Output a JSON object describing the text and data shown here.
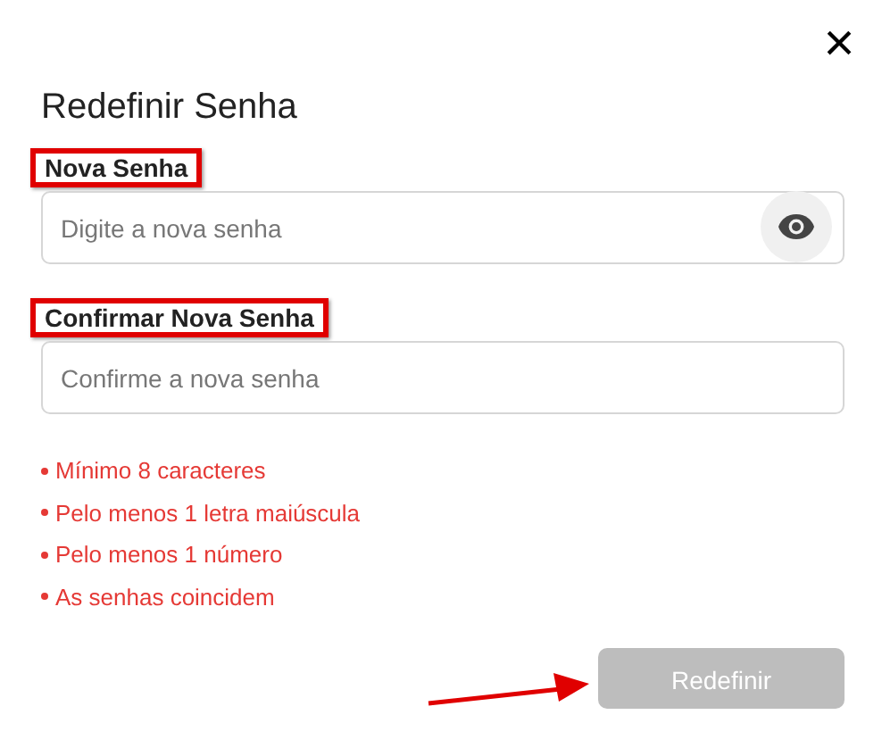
{
  "dialog": {
    "title": "Redefinir Senha",
    "close": "×"
  },
  "fields": [
    {
      "label": "Nova Senha",
      "placeholder": "Digite a nova senha",
      "highlighted": true,
      "reveal_toggle": true
    },
    {
      "label": "Confirmar Nova Senha",
      "placeholder": "Confirme a nova senha",
      "highlighted": true,
      "reveal_toggle": false
    }
  ],
  "requirements": [
    {
      "text": "Mínimo 8 caracteres",
      "met": false
    },
    {
      "text": "Pelo menos 1 letra maiúscula",
      "met": false
    },
    {
      "text": "Pelo menos 1 número",
      "met": false
    },
    {
      "text": "As senhas coincidem",
      "met": false
    }
  ],
  "submit": {
    "label": "Redefinir",
    "disabled": true,
    "pointed_at": true
  }
}
